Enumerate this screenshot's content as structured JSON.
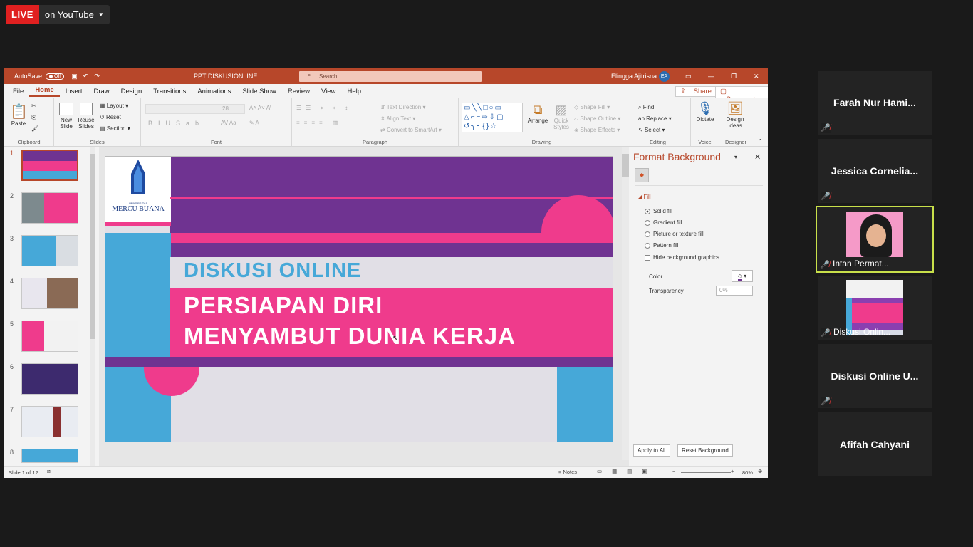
{
  "live": {
    "badge": "LIVE",
    "text": "on YouTube"
  },
  "ppt": {
    "autosave": "AutoSave",
    "autosave_state": "Off",
    "doc_title": "PPT DISKUSIONLINE...",
    "search_placeholder": "Search",
    "user": "Elingga Ajitrisna",
    "user_initials": "EA",
    "menu": [
      "File",
      "Home",
      "Insert",
      "Draw",
      "Design",
      "Transitions",
      "Animations",
      "Slide Show",
      "Review",
      "View",
      "Help"
    ],
    "share": "Share",
    "comments": "Comments",
    "ribbon": {
      "clipboard": "Clipboard",
      "paste": "Paste",
      "slides": "Slides",
      "new_slide": "New Slide",
      "reuse_slides": "Reuse Slides",
      "layout": "Layout",
      "reset": "Reset",
      "section": "Section",
      "font": "Font",
      "font_size": "28",
      "paragraph": "Paragraph",
      "text_direction": "Text Direction",
      "align_text": "Align Text",
      "convert_smartart": "Convert to SmartArt",
      "drawing": "Drawing",
      "arrange": "Arrange",
      "quick_styles": "Quick Styles",
      "shape_fill": "Shape Fill",
      "shape_outline": "Shape Outline",
      "shape_effects": "Shape Effects",
      "editing": "Editing",
      "find": "Find",
      "replace": "Replace",
      "select": "Select",
      "voice": "Voice",
      "dictate": "Dictate",
      "designer": "Designer",
      "design_ideas": "Design Ideas"
    },
    "slides": [
      "1",
      "2",
      "3",
      "4",
      "5",
      "6",
      "7",
      "8"
    ],
    "slide": {
      "logo_small": "UNIVERSITAS",
      "logo": "MERCU BUANA",
      "kicker": "DISKUSI ONLINE",
      "title1": "PERSIAPAN DIRI",
      "title2": "MENYAMBUT DUNIA KERJA"
    },
    "format": {
      "title": "Format Background",
      "fill": "Fill",
      "options": [
        "Solid fill",
        "Gradient fill",
        "Picture or texture fill",
        "Pattern fill"
      ],
      "hide": "Hide background graphics",
      "color": "Color",
      "transparency": "Transparency",
      "transparency_value": "0%",
      "apply_all": "Apply to All",
      "reset_bg": "Reset Background"
    },
    "status": {
      "slide": "Slide 1 of 12",
      "notes": "Notes",
      "zoom": "80%"
    }
  },
  "participants": [
    {
      "name": "Farah Nur Hami..."
    },
    {
      "name": "Jessica  Cornelia..."
    },
    {
      "name": "Intan Permat..."
    },
    {
      "name": "Diskusi Onlin..."
    },
    {
      "name": "Diskusi  Online  U..."
    },
    {
      "name": "Afifah Cahyani"
    }
  ],
  "colors": {
    "ppt_red": "#b7472a",
    "purple": "#7a3a98",
    "pink": "#ef3b8c",
    "blue": "#46a8d8",
    "active_speaker": "#c8e04a"
  }
}
